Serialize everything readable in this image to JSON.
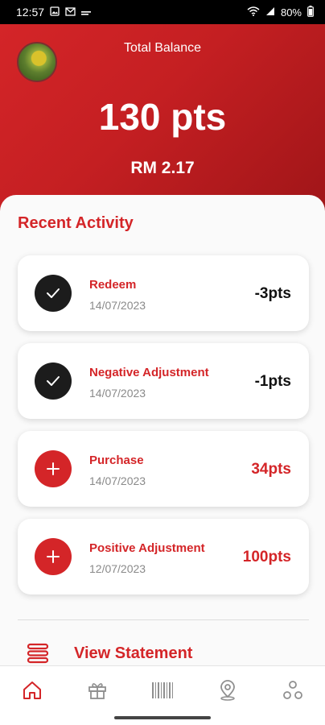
{
  "status_bar": {
    "time": "12:57",
    "battery": "80%"
  },
  "hero": {
    "label": "Total Balance",
    "points": "130 pts",
    "rm_value": "RM 2.17"
  },
  "activity": {
    "title": "Recent Activity",
    "items": [
      {
        "title": "Redeem",
        "date": "14/07/2023",
        "points": "-3pts",
        "icon": "check-icon"
      },
      {
        "title": "Negative Adjustment",
        "date": "14/07/2023",
        "points": "-1pts",
        "icon": "check-icon"
      },
      {
        "title": "Purchase",
        "date": "14/07/2023",
        "points": "34pts",
        "icon": "plus-icon"
      },
      {
        "title": "Positive Adjustment",
        "date": "12/07/2023",
        "points": "100pts",
        "icon": "plus-icon"
      }
    ]
  },
  "statement": {
    "label": "View Statement",
    "icon": "stack-icon"
  },
  "nav": {
    "items": [
      "home-icon",
      "gift-icon",
      "barcode-icon",
      "location-icon",
      "more-circles-icon"
    ]
  },
  "colors": {
    "brand_red": "#d42528",
    "dark_badge": "#1c1c1c"
  }
}
